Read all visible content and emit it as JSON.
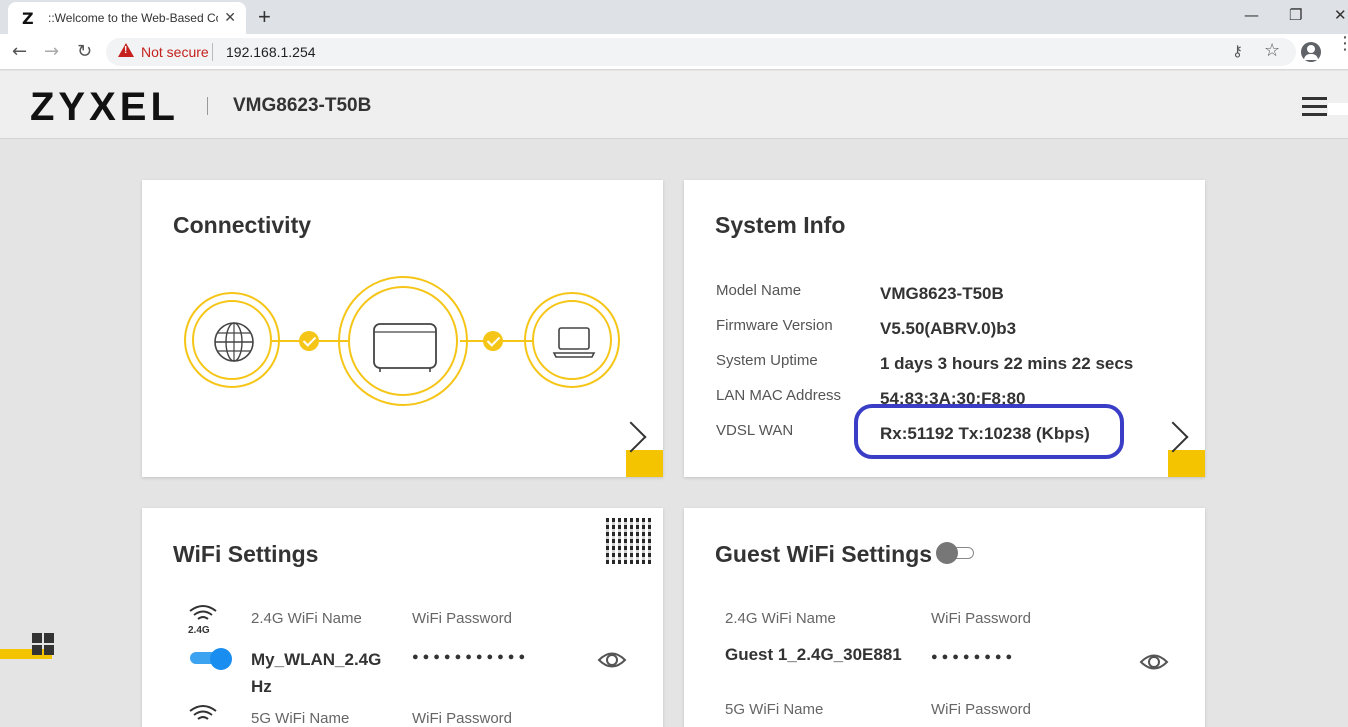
{
  "browser": {
    "tab_favicon": "Z",
    "tab_title": "::Welcome to the Web-Based Co",
    "tab_close": "✕",
    "new_tab": "+",
    "minimize": "—",
    "restore": "❐",
    "close": "✕",
    "back": "←",
    "forward": "→",
    "reload": "↻",
    "not_secure": "Not secure",
    "url": "192.168.1.254",
    "key": "⚷",
    "star": "☆",
    "menu": "⋮"
  },
  "header": {
    "logo": "ZYXEL",
    "model": "VMG8623-T50B"
  },
  "connectivity": {
    "title": "Connectivity",
    "icons": [
      "globe-icon",
      "router-icon",
      "laptop-icon"
    ]
  },
  "system_info": {
    "title": "System Info",
    "rows": [
      {
        "label": "Model Name",
        "value": "VMG8623-T50B"
      },
      {
        "label": "Firmware Version",
        "value": "V5.50(ABRV.0)b3"
      },
      {
        "label": "System Uptime",
        "value": "1 days 3 hours 22 mins 22 secs"
      },
      {
        "label": "LAN MAC Address",
        "value": "54:83:3A:30:F8:80"
      },
      {
        "label": "VDSL WAN",
        "value": "Rx:51192 Tx:10238 (Kbps)"
      }
    ],
    "highlight_color": "#3a3dc6"
  },
  "wifi": {
    "title": "WiFi Settings",
    "band24_badge": "2.4G",
    "name_24_label": "2.4G WiFi Name",
    "password_label": "WiFi Password",
    "name_24_value_line1": "My_WLAN_2.4G",
    "name_24_value_line2": "Hz",
    "password_mask": "●●●●●●●●●●●",
    "name_5_label": "5G WiFi Name",
    "password_5_label": "WiFi Password"
  },
  "guest_wifi": {
    "title": "Guest WiFi Settings",
    "name_24_label": "2.4G WiFi Name",
    "password_label": "WiFi Password",
    "name_24_value": "Guest 1_2.4G_30E881",
    "password_mask": "●●●●●●●●",
    "name_5_label": "5G WiFi Name",
    "password_5_label": "WiFi Password"
  },
  "colors": {
    "accent_yellow": "#f4c400",
    "toggle_blue": "#1a8ef0"
  }
}
